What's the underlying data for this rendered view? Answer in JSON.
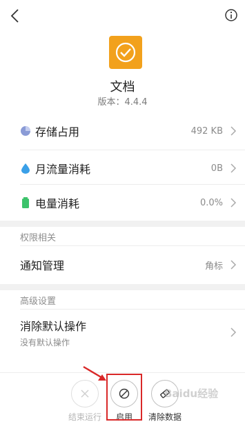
{
  "app": {
    "name": "文档",
    "version": "版本：4.4.4",
    "icon_color": "#f2a11c"
  },
  "usage": [
    {
      "label": "存储占用",
      "value": "492 KB",
      "icon": "pie-chart-icon",
      "icon_color": "#8a9bd6"
    },
    {
      "label": "月流量消耗",
      "value": "0B",
      "icon": "droplet-icon",
      "icon_color": "#3aa0e8"
    },
    {
      "label": "电量消耗",
      "value": "0.0%",
      "icon": "battery-icon",
      "icon_color": "#3cc36b"
    }
  ],
  "permissions": {
    "header": "权限相关",
    "items": [
      {
        "label": "通知管理",
        "value": "角标"
      }
    ]
  },
  "advanced": {
    "header": "高级设置",
    "items": [
      {
        "label": "消除默认操作",
        "sub": "没有默认操作"
      }
    ]
  },
  "actions": [
    {
      "label": "结束运行",
      "icon": "close-icon",
      "enabled": false
    },
    {
      "label": "启用",
      "icon": "block-icon",
      "enabled": true
    },
    {
      "label": "清除数据",
      "icon": "eraser-icon",
      "enabled": true
    }
  ],
  "watermark": "Baidu经验",
  "accent_colors": {
    "highlight": "#d92828"
  }
}
